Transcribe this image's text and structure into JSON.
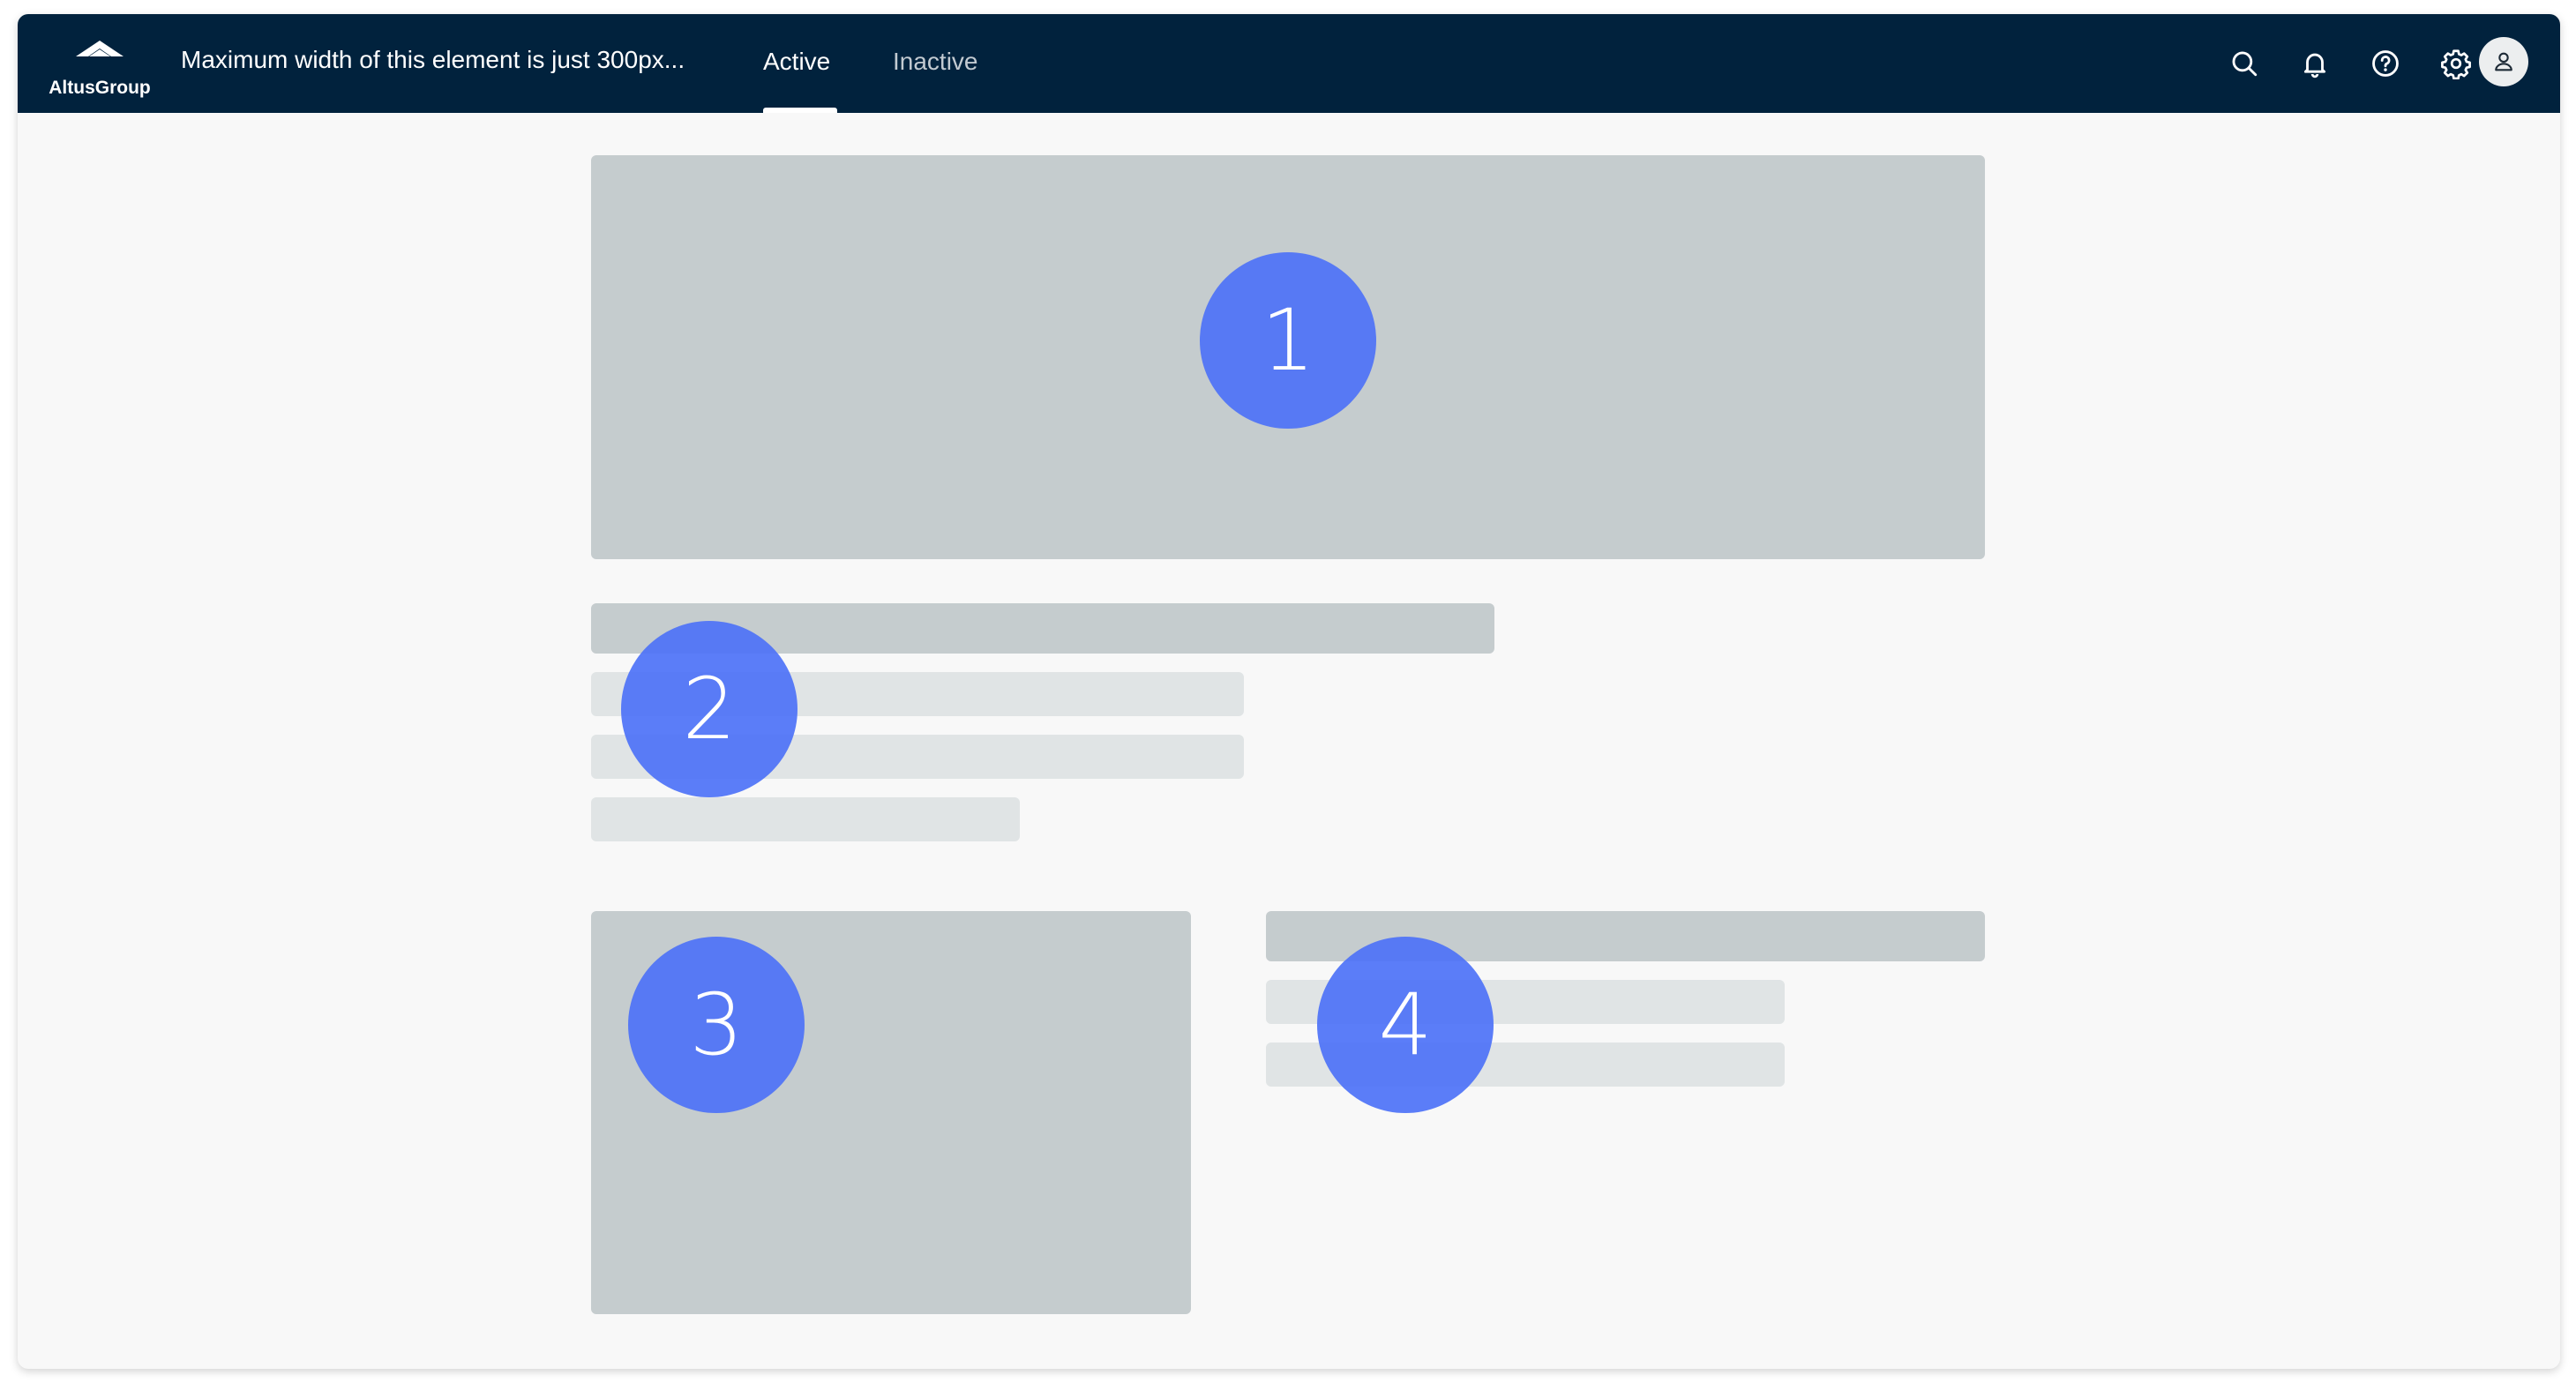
{
  "topbar": {
    "logo_text": "AltusGroup",
    "title": "Maximum width of this element is just 300px...",
    "tabs": [
      {
        "label": "Active",
        "selected": true
      },
      {
        "label": "Inactive",
        "selected": false
      }
    ],
    "icons": [
      "search-icon",
      "bell-icon",
      "help-icon",
      "gear-icon",
      "user-icon"
    ]
  },
  "markers": {
    "m1": "1",
    "m2": "2",
    "m3": "3",
    "m4": "4"
  },
  "colors": {
    "header_bg": "#01223d",
    "marker": "#4d72f7",
    "skeleton_dark": "#c5ccce",
    "skeleton_light": "#e0e4e5",
    "page_bg": "#f8f8f8"
  }
}
